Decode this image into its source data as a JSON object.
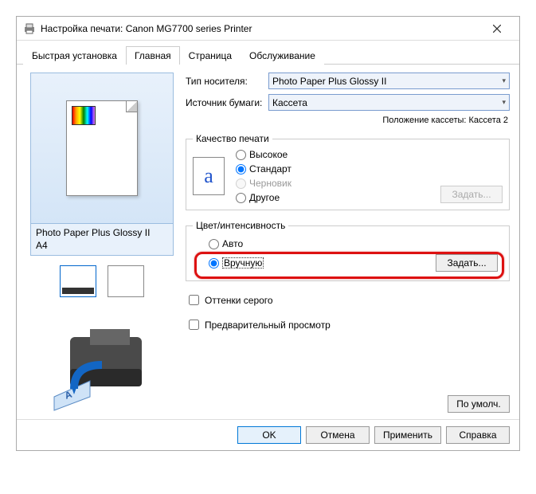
{
  "window": {
    "title": "Настройка печати: Canon MG7700 series Printer"
  },
  "tabs": {
    "items": [
      {
        "label": "Быстрая установка"
      },
      {
        "label": "Главная"
      },
      {
        "label": "Страница"
      },
      {
        "label": "Обслуживание"
      }
    ],
    "active": 1
  },
  "preview": {
    "media_label": "Photo Paper Plus Glossy II",
    "size_label": "A4"
  },
  "media": {
    "type_label": "Тип носителя:",
    "type_value": "Photo Paper Plus Glossy II",
    "source_label": "Источник бумаги:",
    "source_value": "Кассета",
    "cassette_position": "Положение кассеты: Кассета 2"
  },
  "quality": {
    "legend": "Качество печати",
    "options": {
      "high": "Высокое",
      "standard": "Стандарт",
      "draft": "Черновик",
      "other": "Другое"
    },
    "set_button": "Задать..."
  },
  "color": {
    "legend": "Цвет/интенсивность",
    "auto": "Авто",
    "manual": "Вручную",
    "set_button": "Задать..."
  },
  "checks": {
    "grayscale": "Оттенки серого",
    "preview": "Предварительный просмотр"
  },
  "defaults_button": "По умолч.",
  "footer": {
    "ok": "OK",
    "cancel": "Отмена",
    "apply": "Применить",
    "help": "Справка"
  }
}
